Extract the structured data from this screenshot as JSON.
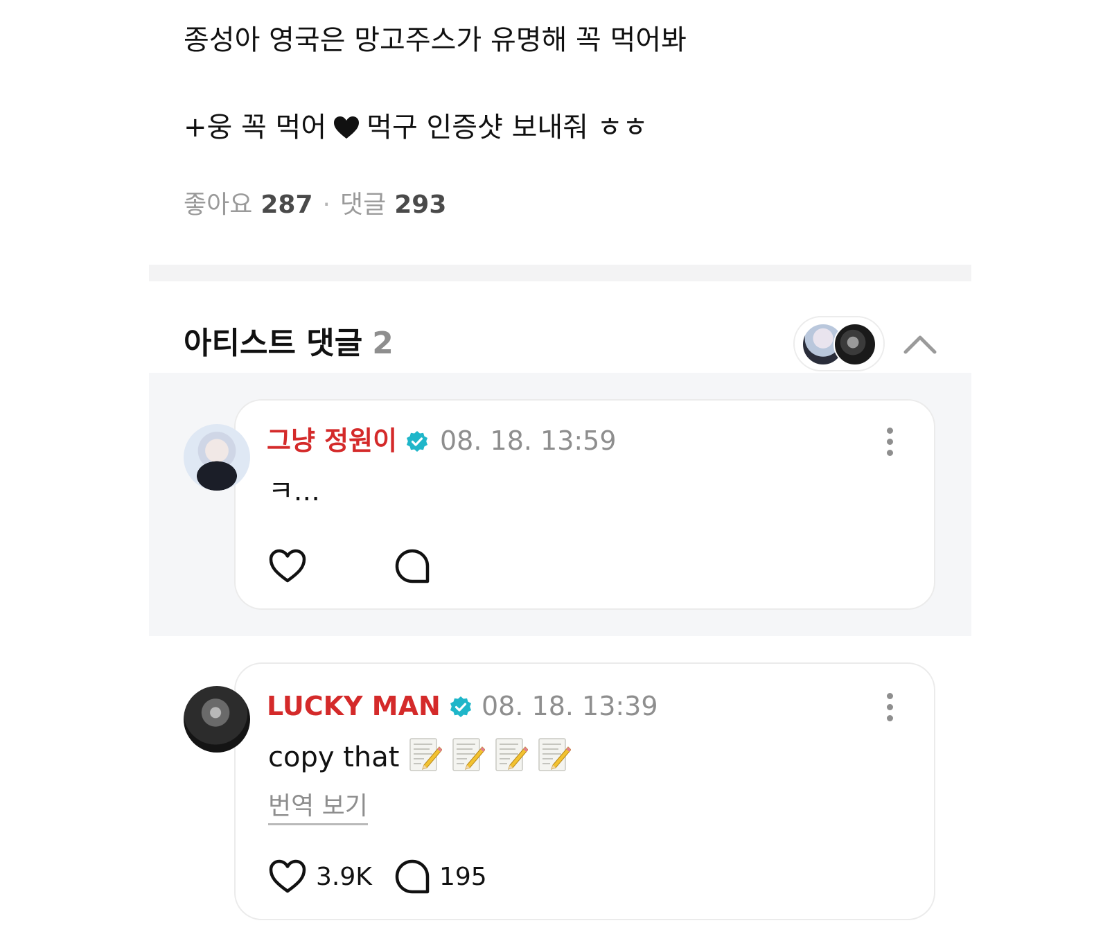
{
  "post": {
    "line1": "종성아 영국은 망고주스가 유명해 꼭 먹어봐",
    "line2_before": "+웅 꼭 먹어",
    "line2_after": "먹구 인증샷 보내줘 ㅎㅎ",
    "line2_icon": "heart-icon"
  },
  "stats": {
    "likes_label": "좋아요",
    "likes_count": "287",
    "separator": "·",
    "comments_label": "댓글",
    "comments_count": "293"
  },
  "artist_comments": {
    "title": "아티스트 댓글",
    "count": "2",
    "collapse_icon": "chevron-up-icon"
  },
  "comments": [
    {
      "author": "그냥 정원이",
      "verified": true,
      "time": "08. 18. 13:59",
      "text": "ㅋ...",
      "like_count": "",
      "reply_count": ""
    },
    {
      "author": "LUCKY MAN",
      "verified": true,
      "time": "08. 18. 13:39",
      "text": "copy that",
      "emoji": "memo-icon",
      "emoji_repeat": 4,
      "translate_label": "번역 보기",
      "like_count": "3.9K",
      "reply_count": "195"
    }
  ],
  "colors": {
    "author": "#d42a2a",
    "verified_badge": "#1fb6c9",
    "muted_text": "#8e8e8e",
    "card_border": "#ebebeb",
    "grey_background": "#f5f6f8"
  }
}
